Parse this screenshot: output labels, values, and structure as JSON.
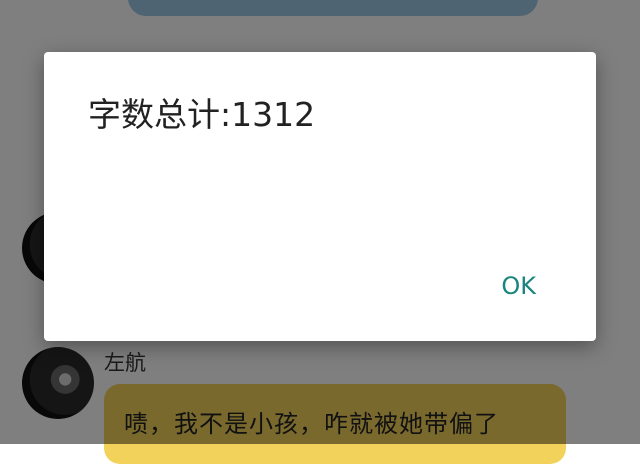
{
  "dialog": {
    "message": "字数总计:1312",
    "ok_label": "OK"
  },
  "chat": {
    "sender_name": "左航",
    "message_text": "啧，我不是小孩，咋就被她带偏了"
  },
  "colors": {
    "scrim": "rgba(0,0,0,0.5)",
    "ok_accent": "#1a857d",
    "bubble_yellow": "#f2d25a",
    "bubble_blue": "#9cc8e6"
  }
}
